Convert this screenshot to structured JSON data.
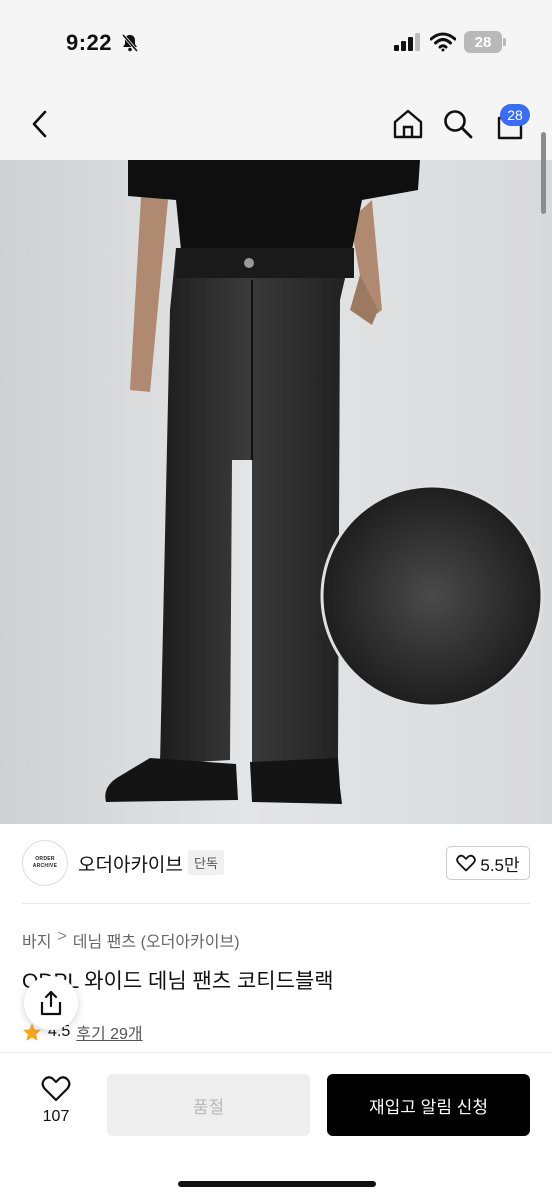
{
  "status_bar": {
    "time": "9:22",
    "battery": "28"
  },
  "nav": {
    "cart_count": "28"
  },
  "brand": {
    "logo_line1": "ORDER",
    "logo_line2": "ARCHIVE",
    "name": "오더아카이브",
    "tag": "단독",
    "likes": "5.5만"
  },
  "breadcrumb": {
    "level1": "바지",
    "separator": ">",
    "level2": "데님 팬츠 (오더아카이브)"
  },
  "product": {
    "title": "ODPL 와이드 데님 팬츠 코티드블랙",
    "rating": "4.5",
    "reviews": "후기 29개"
  },
  "actions": {
    "wish_count": "107",
    "soldout_label": "품절",
    "restock_label": "재입고 알림 신청"
  },
  "colors": {
    "badge": "#3a6df0",
    "primary_button": "#000000",
    "star": "#f5a623"
  }
}
